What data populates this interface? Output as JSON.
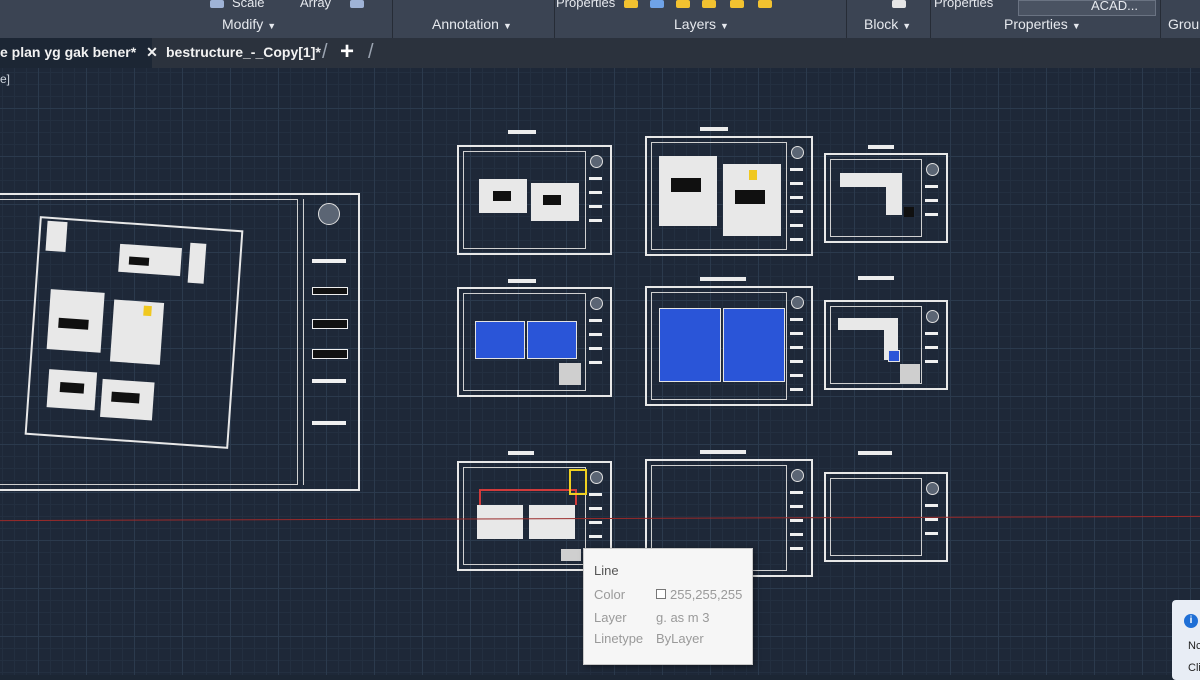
{
  "ribbon": {
    "panels": [
      "Modify",
      "Annotation",
      "Layers",
      "Block",
      "Properties",
      "Group"
    ],
    "fragments": [
      "Scale",
      "Array",
      "Properties",
      "Properties",
      "ACAD..."
    ]
  },
  "tabs": {
    "items": [
      {
        "label": "e plan yg gak bener*",
        "close": "✕"
      },
      {
        "label": "bestructure_-_Copy[1]*"
      }
    ],
    "new_tab": "+"
  },
  "viewport_label": "e]",
  "tooltip": {
    "title": "Line",
    "rows": [
      {
        "label": "Color",
        "value": "255,255,255"
      },
      {
        "label": "Layer",
        "value": "g. as m 3"
      },
      {
        "label": "Linetype",
        "value": "ByLayer"
      }
    ]
  },
  "notification": {
    "lines": [
      "Nc",
      "Cli"
    ]
  },
  "colors": {
    "canvas": "#1e2838",
    "ribbon": "#3b4453",
    "tab_bar": "#2b323d",
    "plan_blue": "#2a55d8",
    "selection_red": "#d23b3b",
    "selection_yellow": "#f0d020"
  }
}
